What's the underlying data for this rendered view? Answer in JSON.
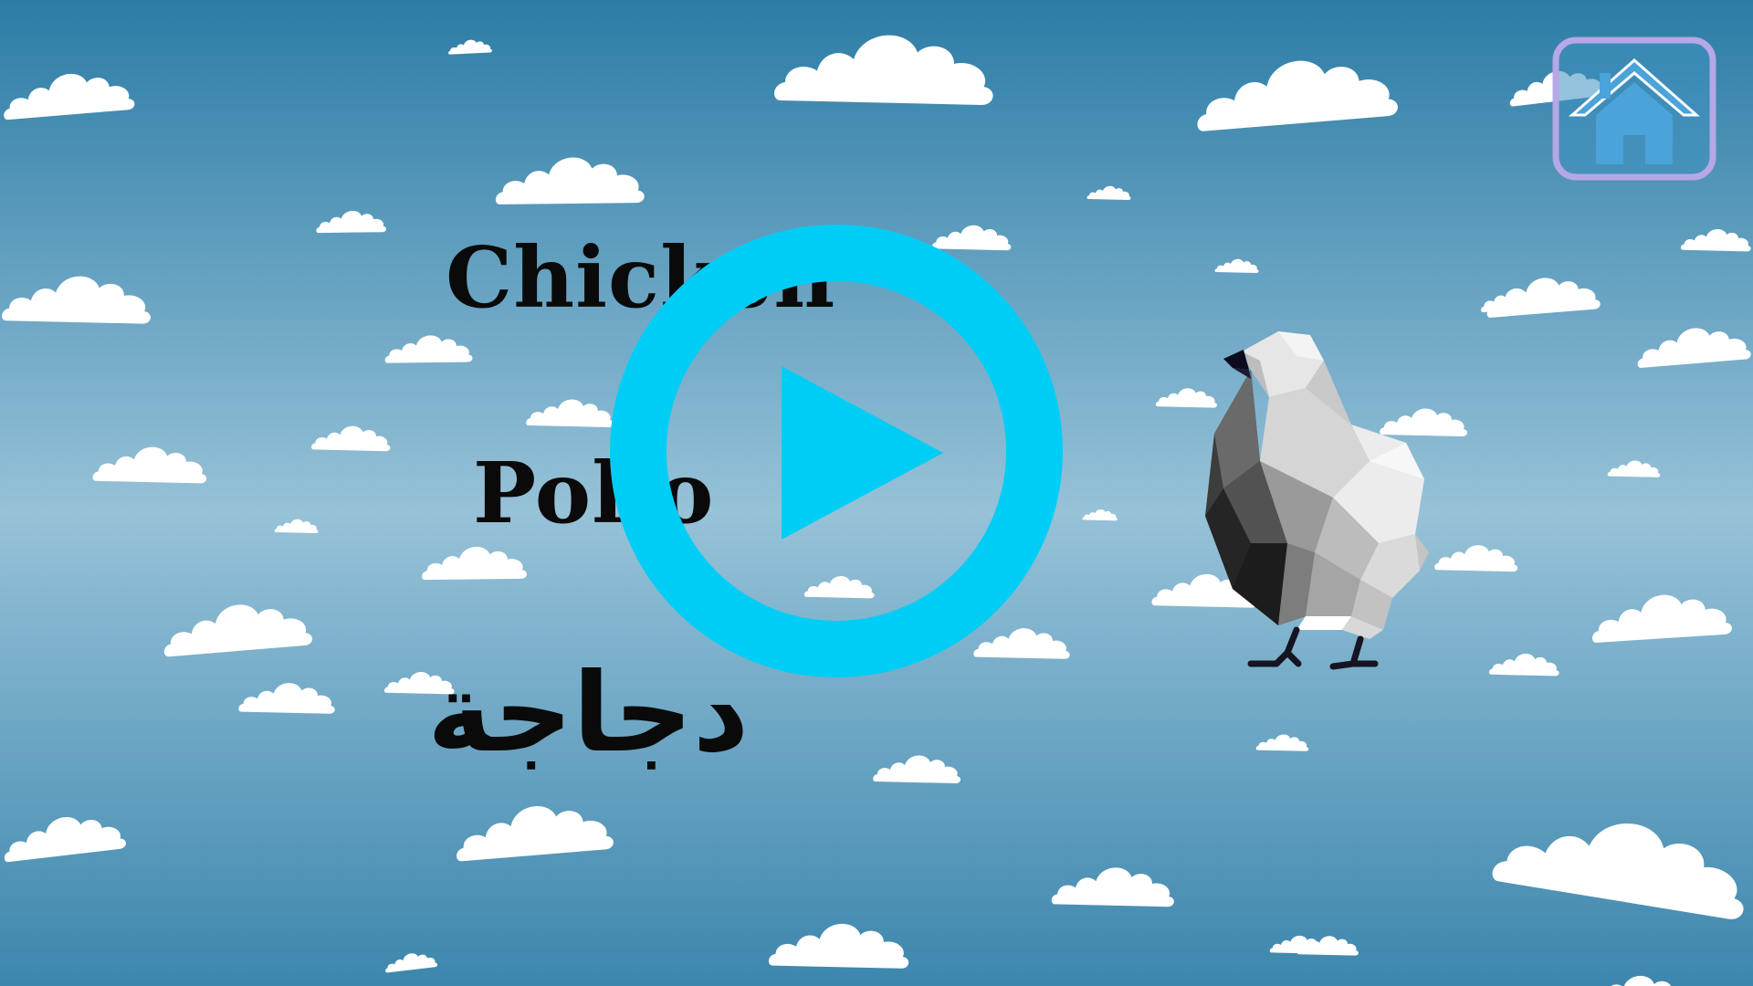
{
  "scene": {
    "type": "vocabulary-flashcard",
    "background": "sky-with-clouds",
    "sky_colors": {
      "top": "#2c7ca6",
      "middle": "#97c2d8",
      "bottom": "#3c86ad"
    },
    "cloud_color": "#ffffff"
  },
  "words": {
    "english": "Chicken",
    "italian": "Pollo",
    "arabic": "دجاجة"
  },
  "controls": {
    "play_button": {
      "icon": "play-icon",
      "color": "#00cdf6"
    },
    "home_button": {
      "icon": "home-icon",
      "frame_color": "#b6a7e6",
      "icon_color": "#4aa3d9"
    }
  },
  "image": {
    "subject": "chicken-icon",
    "style": "low-poly"
  }
}
